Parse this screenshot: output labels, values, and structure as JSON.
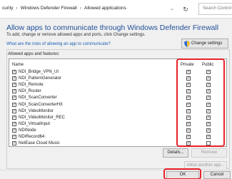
{
  "address_bar": {
    "crumbs": [
      "curity",
      "Windows Defender Firewall",
      "Allowed applications"
    ],
    "search_placeholder": "Search Control"
  },
  "heading": "Allow apps to communicate through Windows Defender Firewall",
  "subheading": "To add, change or remove allowed apps and ports, click Change settings.",
  "risk_link": "What are the risks of allowing an app to communicate?",
  "change_settings_label": "Change settings",
  "group_label": "Allowed apps and features:",
  "columns": {
    "name": "Name",
    "private": "Private",
    "public": "Public"
  },
  "apps": [
    {
      "name": "NDI_Bridge_VPN_UI",
      "enabled": true,
      "private": true,
      "public": true
    },
    {
      "name": "NDI_PatternGenerator",
      "enabled": true,
      "private": true,
      "public": true
    },
    {
      "name": "NDI_Remote",
      "enabled": true,
      "private": true,
      "public": true
    },
    {
      "name": "NDI_Router",
      "enabled": true,
      "private": true,
      "public": true
    },
    {
      "name": "NDI_ScanConverter",
      "enabled": true,
      "private": true,
      "public": true
    },
    {
      "name": "NDI_ScanConverterHX",
      "enabled": true,
      "private": true,
      "public": true
    },
    {
      "name": "NDI_VideoMonitor",
      "enabled": true,
      "private": true,
      "public": true
    },
    {
      "name": "NDI_VideoMonitor_REC",
      "enabled": true,
      "private": true,
      "public": true
    },
    {
      "name": "NDI_VirtualInput",
      "enabled": true,
      "private": true,
      "public": true
    },
    {
      "name": "NDINode",
      "enabled": true,
      "private": true,
      "public": true
    },
    {
      "name": "NDIRecord64",
      "enabled": true,
      "private": true,
      "public": true
    },
    {
      "name": "NetEase Cloud Music",
      "enabled": true,
      "private": true,
      "public": false
    }
  ],
  "details_label": "Details...",
  "remove_label": "Remove",
  "allow_another_label": "Allow another app...",
  "ok_label": "OK",
  "cancel_label": "Cancel",
  "colors": {
    "highlight": "#e8222a",
    "heading": "#1f4e99",
    "link": "#1a5fb4"
  }
}
